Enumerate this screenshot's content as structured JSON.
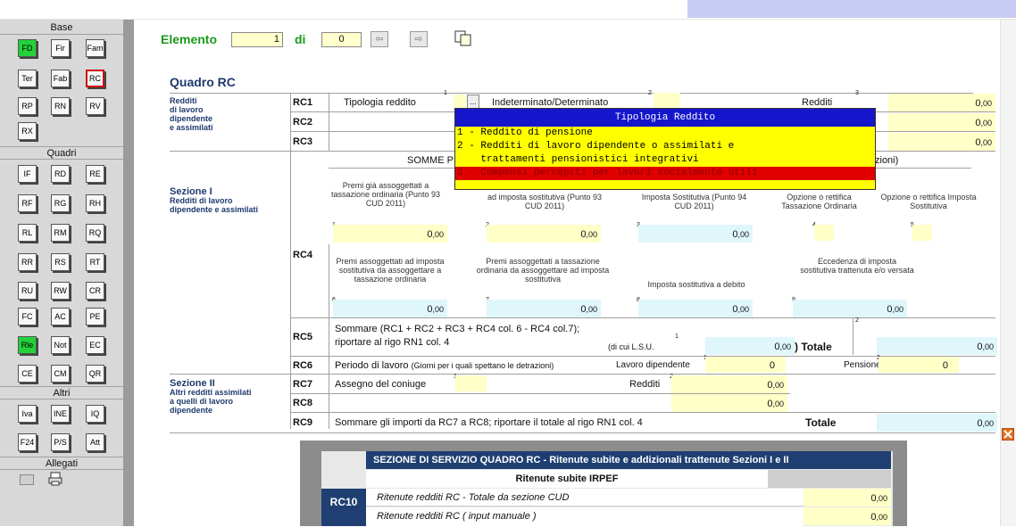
{
  "sidebar": {
    "sections": [
      {
        "header": "Base",
        "items": [
          "FD",
          "Fir",
          "Fam",
          "Ter",
          "Fab",
          "RC",
          "RP",
          "RN",
          "RV",
          "RX"
        ]
      },
      {
        "header": "Quadri",
        "items": [
          "IF",
          "RD",
          "RE",
          "RF",
          "RG",
          "RH",
          "RL",
          "RM",
          "RQ",
          "RR",
          "RS",
          "RT",
          "RU",
          "RW",
          "CR",
          "FC",
          "AC",
          "PE",
          "Rle",
          "Not",
          "EC",
          "CE",
          "CM",
          "QR"
        ]
      },
      {
        "header": "Altri",
        "items": [
          "Iva",
          "INE",
          "IQ",
          "F24",
          "P/S",
          "Att"
        ]
      },
      {
        "header": "Allegati",
        "items": []
      }
    ]
  },
  "toolbar": {
    "element_label": "Elemento",
    "element_value": "1",
    "of_label": "di",
    "of_value": "0"
  },
  "form": {
    "title": "Quadro RC",
    "group1": {
      "title": "Redditi",
      "lines": [
        "di lavoro",
        "dipendente",
        "e assimilati"
      ]
    },
    "rc1": {
      "code": "RC1",
      "tipologia": "Tipologia reddito",
      "tipo_btn": "...",
      "det": "Indeterminato/Determinato",
      "redditi": "Redditi",
      "value": "0"
    },
    "rc2": {
      "code": "RC2",
      "value": "0"
    },
    "rc3": {
      "code": "RC3",
      "value": "0"
    },
    "somme_prefix": "SOMME PER",
    "somme_suffix": "zioni)",
    "sezione1": {
      "title": "Sezione I",
      "lines": [
        "Redditi di lavoro",
        "dipendente e assimilati"
      ]
    },
    "rc4": {
      "code": "RC4",
      "col1": "Premi già assoggettati a tassazione ordinaria (Punto 93 CUD 2011)",
      "col2": "ad imposta sostitutiva (Punto 93 CUD 2011)",
      "col3": "Imposta Sostitutiva (Punto 94 CUD 2011)",
      "col4": "Opzione o rettifica Tassazione Ordinaria",
      "col5": "Opzione o rettifica Imposta Sostitutiva",
      "col6": "Premi assoggettati ad imposta sostitutiva da assoggettare a tassazione ordinaria",
      "col7": "Premi assoggettati a tassazione ordinaria da assoggettare ad imposta sostitutiva",
      "col8": "Imposta sostitutiva a debito",
      "col9": "Eccedenza di imposta sostitutiva trattenuta e/o versata",
      "v1": "0",
      "v2": "0",
      "v3": "0",
      "v6": "0",
      "v7": "0",
      "v8": "0",
      "v9": "0"
    },
    "rc5": {
      "code": "RC5",
      "text1": "Sommare (RC1 + RC2 + RC3 + RC4 col. 6 - RC4 col.7);",
      "text2": "riportare al rigo RN1 col. 4",
      "lsu": "(di cui L.S.U.",
      "lsu_val": "0",
      "totale": "Totale",
      "tot_val": "0"
    },
    "rc6": {
      "code": "RC6",
      "text": "Periodo di lavoro",
      "note": "(Giorni per i quali spettano le detrazioni)",
      "lav": "Lavoro dipendente",
      "lav_val": "0",
      "pens": "Pensione",
      "pens_val": "0"
    },
    "sezione2": {
      "title": "Sezione II",
      "lines": [
        "Altri redditi assimilati",
        "a quelli di lavoro",
        "dipendente"
      ]
    },
    "rc7": {
      "code": "RC7",
      "text": "Assegno del coniuge",
      "redditi": "Redditi",
      "value": "0"
    },
    "rc8": {
      "code": "RC8",
      "value": "0"
    },
    "rc9": {
      "code": "RC9",
      "text": "Sommare gli importi da RC7 a RC8; riportare il totale al rigo RN1 col. 4",
      "totale": "Totale",
      "value": "0"
    },
    "dec": ",00"
  },
  "dropdown": {
    "title": "Tipologia Reddito",
    "options": [
      "1 - Reddito di pensione",
      "2 - Redditi di lavoro dipendente o assimilati e",
      "    trattamenti pensionistici integrativi",
      "3 - Compensi percepiti per lavori socialmente utili"
    ]
  },
  "service": {
    "title": "SEZIONE DI SERVIZIO QUADRO RC - Ritenute subite e addizionali trattenute Sezioni I e II",
    "sub": "Ritenute subite IRPEF",
    "rc10": "RC10",
    "row1": "Ritenute redditi RC - Totale da sezione CUD",
    "row2": "Ritenute redditi RC ( input manuale )",
    "v1": "0",
    "v2": "0"
  }
}
